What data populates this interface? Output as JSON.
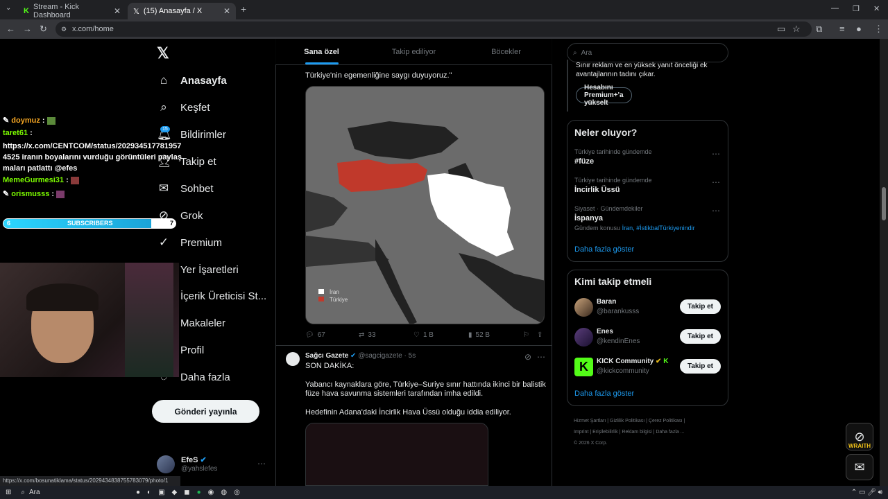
{
  "browser": {
    "tabs": [
      {
        "title": "Stream - Kick Dashboard",
        "icon": "kick-icon"
      },
      {
        "title": "(15) Anasayfa / X",
        "icon": "x-logo-icon"
      }
    ],
    "url": "x.com/home",
    "status_url": "https://x.com/bosunatiklama/status/2029434838755783079/photo/1"
  },
  "sidebar": {
    "logo": "𝕏",
    "notification_count": "15",
    "items": [
      {
        "label": "Anasayfa",
        "icon": "home-icon"
      },
      {
        "label": "Keşfet",
        "icon": "search-icon"
      },
      {
        "label": "Bildirimler",
        "icon": "bell-icon"
      },
      {
        "label": "Takip et",
        "icon": "people-icon"
      },
      {
        "label": "Sohbet",
        "icon": "mail-icon"
      },
      {
        "label": "Grok",
        "icon": "grok-icon"
      },
      {
        "label": "Premium",
        "icon": "verified-icon"
      },
      {
        "label": "Yer İşaretleri",
        "icon": "bookmark-icon"
      },
      {
        "label": "İçerik Üreticisi St...",
        "icon": "studio-icon"
      },
      {
        "label": "Makaleler",
        "icon": "article-icon"
      },
      {
        "label": "Profil",
        "icon": "profile-icon"
      },
      {
        "label": "Daha fazla",
        "icon": "more-icon"
      }
    ],
    "post_button": "Gönderi yayınla",
    "account": {
      "name": "EfeS",
      "handle": "@yahslefes"
    }
  },
  "feed": {
    "tabs": [
      "Sana özel",
      "Takip ediliyor",
      "Böcekler"
    ],
    "tweet1": {
      "text_tail": "Türkiye'nin egemenliğine saygı duyuyoruz.\"",
      "map_legend": [
        "İran",
        "Türkiye"
      ],
      "replies": "67",
      "retweets": "33",
      "likes": "1 B",
      "views": "52 B"
    },
    "tweet2": {
      "author": "Sağcı Gazete",
      "handle": "@sagcigazete",
      "time": "5s",
      "line1": "SON DAKİKA:",
      "para1": "Yabancı kaynaklara göre, Türkiye–Suriye sınır hattında ikinci bir balistik füze hava savunma sistemleri tarafından imha edildi.",
      "para2": "Hedefinin Adana'daki İncirlik Hava Üssü olduğu iddia ediliyor."
    }
  },
  "right": {
    "search_placeholder": "Ara",
    "premium_text": "Sınır reklam ve en yüksek yanıt önceliği ek avantajlarının tadını çıkar.",
    "premium_button": "Hesabını Premium+'a yükselt",
    "trends_title": "Neler oluyor?",
    "trends": [
      {
        "context": "Türkiye tarihinde gündemde",
        "title": "#füze",
        "extra": ""
      },
      {
        "context": "Türkiye tarihinde gündemde",
        "title": "İncirlik Üssü",
        "extra": ""
      },
      {
        "context": "Siyaset · Gündemdekiler",
        "title": "İspanya",
        "extra_label": "Gündem konusu",
        "extra_links": "İran, #İstikbalTürkiyenindir"
      }
    ],
    "show_more": "Daha fazla göster",
    "follow_title": "Kimi takip etmeli",
    "follow": [
      {
        "name": "Baran",
        "handle": "@barankusss",
        "button": "Takip et"
      },
      {
        "name": "Enes",
        "handle": "@kendinEnes",
        "button": "Takip et"
      },
      {
        "name": "KICK Community",
        "handle": "@kickcommunity",
        "button": "Takip et"
      }
    ],
    "footer": [
      "Hizmet Şartları",
      "Gizlilik Politikası",
      "Çerez Politikası",
      "Imprint",
      "Erişilebilirlik",
      "Reklam bilgisi",
      "Daha fazla ...",
      "© 2026 X Corp."
    ]
  },
  "overlay": {
    "chat": [
      {
        "user": "doymuz",
        "msg": ":",
        "color": "#f5a623"
      },
      {
        "user": "taret61",
        "msg": ":",
        "color": "#7CFC00"
      },
      {
        "user": "",
        "msg": "https://x.com/CENTCOM/status/2029345177819574525 iranın boyalarını vurduğu görüntüleri paylaşmaları patlattı @efes",
        "color": "#ffffff"
      },
      {
        "user": "MemeGurmesi31",
        "msg": ":",
        "color": "#7CFC00"
      },
      {
        "user": "orismusss",
        "msg": ":",
        "color": "#7CFC00"
      }
    ],
    "subs_label": "SUBSCRIBERS",
    "subs_current": "6",
    "subs_goal": "7",
    "subs_progress": 0.86,
    "widget_label": "WRAITH"
  },
  "taskbar": {
    "search": "Ara"
  }
}
